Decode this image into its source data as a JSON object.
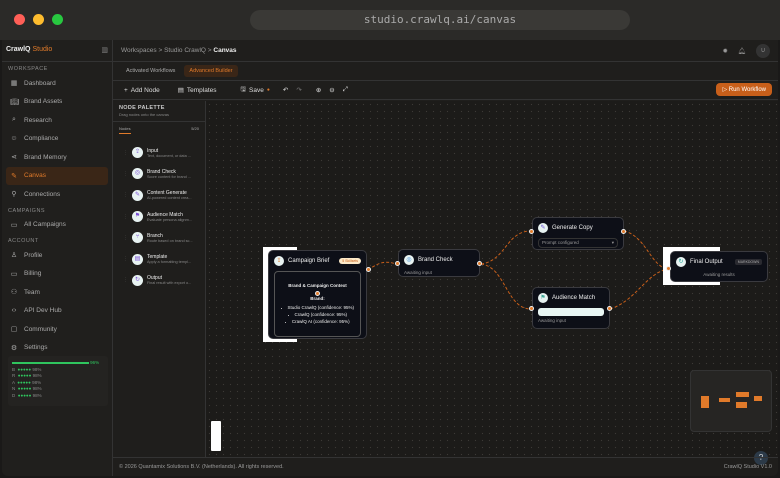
{
  "browser": {
    "url": "studio.crawlq.ai/canvas"
  },
  "brand": {
    "name": "CrawlQ",
    "suffix": "Studio"
  },
  "sidebar": {
    "workspace_label": "WORKSPACE",
    "workspace": [
      {
        "label": "Dashboard",
        "icon": "grid-icon"
      },
      {
        "label": "Brand Assets",
        "icon": "book-icon"
      },
      {
        "label": "Research",
        "icon": "search-icon"
      },
      {
        "label": "Compliance",
        "icon": "shield-icon"
      },
      {
        "label": "Brand Memory",
        "icon": "share-icon"
      },
      {
        "label": "Canvas",
        "icon": "canvas-icon",
        "active": true
      },
      {
        "label": "Connections",
        "icon": "plug-icon"
      }
    ],
    "campaigns_label": "CAMPAIGNS",
    "campaigns": [
      {
        "label": "All Campaigns",
        "icon": "folder-icon"
      }
    ],
    "account_label": "ACCOUNT",
    "account": [
      {
        "label": "Profile",
        "icon": "user-icon"
      },
      {
        "label": "Billing",
        "icon": "card-icon"
      },
      {
        "label": "Team",
        "icon": "team-icon"
      },
      {
        "label": "API Dev Hub",
        "icon": "code-icon"
      },
      {
        "label": "Community",
        "icon": "chat-icon"
      },
      {
        "label": "Settings",
        "icon": "gear-icon"
      }
    ],
    "score": {
      "total": "96%",
      "total_value": 96,
      "rows": [
        {
          "k": "B",
          "v": "98%"
        },
        {
          "k": "R",
          "v": "98%"
        },
        {
          "k": "A",
          "v": "98%"
        },
        {
          "k": "N",
          "v": "98%"
        },
        {
          "k": "D",
          "v": "98%"
        }
      ]
    }
  },
  "breadcrumb": [
    "Workspaces",
    "Studio CrawlQ",
    "Canvas"
  ],
  "user": {
    "initial": "U"
  },
  "tabs": [
    {
      "label": "Activated Workflows"
    },
    {
      "label": "Advanced Builder",
      "active": true
    }
  ],
  "toolbar": {
    "add_node": "Add Node",
    "templates": "Templates",
    "save": "Save",
    "run": "Run Workflow"
  },
  "palette": {
    "title": "NODE PALETTE",
    "hint": "Drag nodes onto the canvas",
    "tab": "Nodes",
    "count": "5/20",
    "items": [
      {
        "title": "Input",
        "desc": "Text, document, or data ...",
        "icon": "⇪"
      },
      {
        "title": "Brand Check",
        "desc": "Score content for brand ...",
        "icon": "◎"
      },
      {
        "title": "Content Generate",
        "desc": "AI-powered content crea...",
        "icon": "✎"
      },
      {
        "title": "Audience Match",
        "desc": "Evaluate persona alignm...",
        "icon": "⚑"
      },
      {
        "title": "Branch",
        "desc": "Route based on brand sc...",
        "icon": "⑂"
      },
      {
        "title": "Template",
        "desc": "Apply a formatting templ...",
        "icon": "▤"
      },
      {
        "title": "Output",
        "desc": "Final result with export o...",
        "icon": "↻"
      }
    ]
  },
  "nodes": {
    "brief": {
      "title": "Campaign Brief",
      "badge": "5 Skillsets",
      "context_title": "Brand & Campaign Context",
      "brand_label": "Brand:",
      "bullets": [
        "Studio CrawlQ (confidence: 95%)",
        "CrawlQ (confidence: 95%)",
        "CrawlQ AI (confidence: 95%)"
      ]
    },
    "brand_check": {
      "title": "Brand Check",
      "status": "Awaiting input"
    },
    "generate": {
      "title": "Generate Copy",
      "select": "Prompt configured"
    },
    "audience": {
      "title": "Audience Match",
      "status": "Awaiting input"
    },
    "output": {
      "title": "Final Output",
      "badge": "MARKDOWN",
      "status": "Awaiting results"
    }
  },
  "footer": {
    "copyright": "© 2026 Quantamix Solutions B.V. (Netherlands). All rights reserved.",
    "version": "CrawlQ Studio V1.0"
  }
}
